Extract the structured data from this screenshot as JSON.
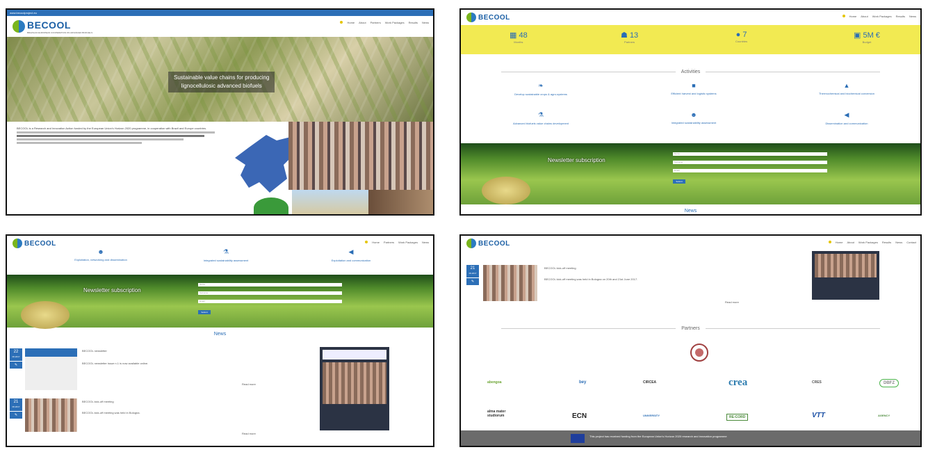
{
  "brand": {
    "name": "BECOOL",
    "subtitle": "BRAZILIAN EUROPEAN COOPERATION ON ADVANCED BIOFUELS"
  },
  "colors": {
    "primary": "#2c6fb7",
    "stats_band": "#f2ea52",
    "footer": "#6b6b6b"
  },
  "nav": [
    "Home",
    "About",
    "Partners",
    "Work Packages",
    "Results",
    "News",
    "Events",
    "Contact"
  ],
  "panel1": {
    "topbar": "www.becoolproject.eu",
    "hero_line1": "Sustainable value chains for producing",
    "hero_line2": "lignocellulosic advanced biofuels",
    "intro_lead": "BECOOL is a Research and Innovation Action funded by the European Union's Horizon 2020 programme, in cooperation with Brazil and Europe countries."
  },
  "panel2": {
    "stats": [
      {
        "value": "48",
        "label": "Months",
        "icon": "calendar-icon"
      },
      {
        "value": "13",
        "label": "Partners",
        "icon": "group-icon"
      },
      {
        "value": "7",
        "label": "Countries",
        "icon": "globe-icon"
      },
      {
        "value": "5M €",
        "label": "Budget",
        "icon": "money-icon"
      }
    ],
    "activities_title": "Activities",
    "activities": [
      {
        "icon": "leaf-icon",
        "label": "Develop sustainable crops & agro-systems"
      },
      {
        "icon": "truck-icon",
        "label": "Efficient harvest and logistic systems"
      },
      {
        "icon": "drop-icon",
        "label": "Thermochemical and biochemical conversion"
      },
      {
        "icon": "flask-icon",
        "label": "Advanced biofuels value chains development"
      },
      {
        "icon": "people-icon",
        "label": "Integrated sustainability assessment"
      },
      {
        "icon": "megaphone-icon",
        "label": "Dissemination and communication"
      }
    ],
    "newsletter_title": "Newsletter subscription",
    "fields": [
      "Name",
      "Surname",
      "Email"
    ],
    "submit": "Submit",
    "news_title": "News"
  },
  "panel3": {
    "activities": [
      {
        "icon": "people-icon",
        "label": "Exploitation, networking and dissemination"
      },
      {
        "icon": "flask-icon",
        "label": "Integrated sustainability assessment"
      },
      {
        "icon": "megaphone-icon",
        "label": "Exploitation and communication"
      }
    ],
    "newsletter_title": "Newsletter subscription",
    "fields": [
      "Name",
      "Surname",
      "Email"
    ],
    "submit": "Submit",
    "news_title": "News",
    "news": [
      {
        "day": "22",
        "month": "06.2017",
        "title": "BECOOL newsletter",
        "body": "BECOOL newsletter issue n.1 is now available online."
      },
      {
        "day": "21",
        "month": "06.2017",
        "title": "BECOOL kick-off meeting",
        "body": "BECOOL kick-off meeting was held in Bologna."
      }
    ],
    "read_more": "Read more"
  },
  "panel4": {
    "news": {
      "day": "21",
      "month": "06.2017",
      "title": "BECOOL kick-off meeting",
      "body": "BECOOL kick-off meeting was held in Bologna on 20th and 21st June 2017."
    },
    "read_more": "Read more",
    "partners_title": "Partners",
    "partners_row1": [
      "abengoa",
      "bey",
      "CIRCEA",
      "crea",
      "CRES",
      "DBFZ"
    ],
    "partners_row2": [
      "alma mater studiorum",
      "ECN",
      "UNIVERSITY",
      "RE-CORD",
      "VTT",
      "AGENCY"
    ],
    "footer_text": "This project has received funding from the European Union's Horizon 2020 research and innovation programme"
  }
}
